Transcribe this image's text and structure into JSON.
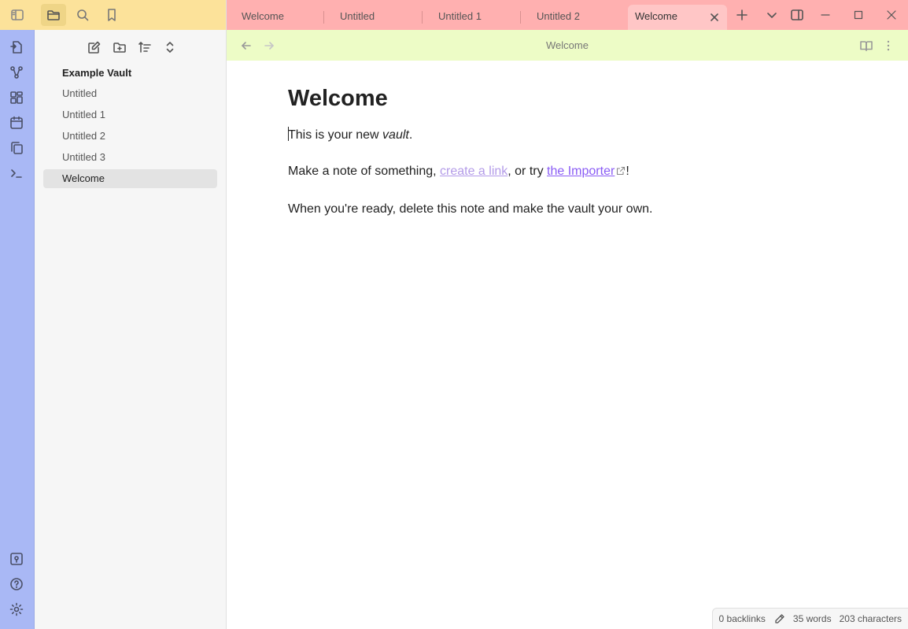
{
  "sidebar": {
    "vault_name": "Example Vault",
    "files": [
      {
        "label": "Untitled",
        "active": false
      },
      {
        "label": "Untitled 1",
        "active": false
      },
      {
        "label": "Untitled 2",
        "active": false
      },
      {
        "label": "Untitled 3",
        "active": false
      },
      {
        "label": "Welcome",
        "active": true
      }
    ]
  },
  "tabs": [
    {
      "label": "Welcome",
      "active": false
    },
    {
      "label": "Untitled",
      "active": false
    },
    {
      "label": "Untitled 1",
      "active": false
    },
    {
      "label": "Untitled 2",
      "active": false
    },
    {
      "label": "Welcome",
      "active": true
    }
  ],
  "view": {
    "title": "Welcome"
  },
  "note": {
    "title": "Welcome",
    "p1_before": "This is your new ",
    "p1_em": "vault",
    "p1_after": ".",
    "p2_before": "Make a note of something, ",
    "p2_internal_link": "create a link",
    "p2_middle": ", or try ",
    "p2_external_link": "the Importer",
    "p2_after": "!",
    "p3": "When you're ready, delete this note and make the vault your own."
  },
  "status": {
    "backlinks": "0 backlinks",
    "words": "35 words",
    "characters": "203 characters"
  },
  "colors": {
    "ribbon": "#a9b8f5",
    "sidebar_header": "#fce29a",
    "tabbar": "#ffb0b0",
    "view_header": "#edfcc6",
    "internal_link": "#b39be8",
    "external_link": "#8a5cf5"
  }
}
